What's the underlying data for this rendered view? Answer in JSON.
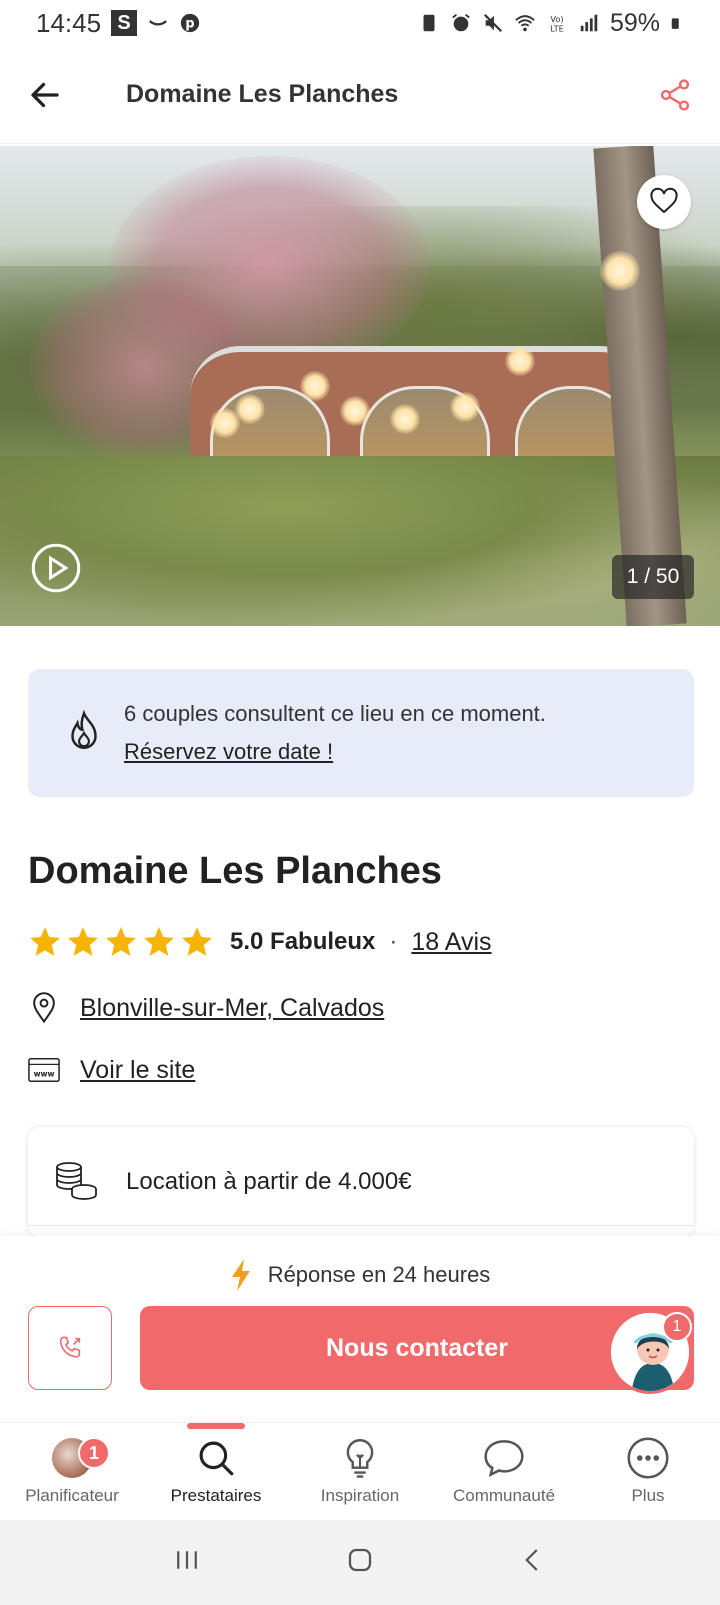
{
  "status_bar": {
    "time": "14:45",
    "s_icon_label": "S",
    "battery": "59%",
    "icons": [
      "s-app-icon",
      "amazon-icon",
      "pinterest-icon",
      "battery-saver-icon",
      "alarm-icon",
      "mute-icon",
      "wifi-icon",
      "volte-icon",
      "signal-icon",
      "battery-icon"
    ]
  },
  "app_bar": {
    "title": "Domaine Les Planches",
    "back_icon": "arrow-left-icon",
    "share_icon": "share-icon"
  },
  "hero": {
    "counter": "1 / 50",
    "favorite_icon": "heart-icon",
    "play_icon": "play-icon"
  },
  "banner": {
    "icon": "flame-icon",
    "line1": "6 couples consultent ce lieu en ce moment.",
    "link": "Réservez votre date !"
  },
  "venue": {
    "title": "Domaine Les Planches",
    "rating": 5,
    "rating_label": "5.0 Fabuleux",
    "separator": "·",
    "reviews": "18 Avis",
    "location": "Blonville-sur-Mer, Calvados",
    "website": "Voir le site"
  },
  "price": {
    "icon": "coins-icon",
    "text": "Location à partir de 4.000€"
  },
  "contact": {
    "response_icon": "lightning-icon",
    "response_text": "Réponse en 24 heures",
    "call_icon": "phone-icon",
    "button_label": "Nous contacter",
    "agent_badge": "1"
  },
  "bottom_nav": {
    "items": [
      {
        "label": "Planificateur",
        "icon": "planner-avatar",
        "badge": "1"
      },
      {
        "label": "Prestataires",
        "icon": "search-icon",
        "active": true
      },
      {
        "label": "Inspiration",
        "icon": "lightbulb-icon"
      },
      {
        "label": "Communauté",
        "icon": "chat-bubble-icon"
      },
      {
        "label": "Plus",
        "icon": "more-icon"
      }
    ]
  },
  "colors": {
    "accent": "#f06a6b",
    "banner_bg": "#e7ecf8",
    "star": "#f5b400"
  }
}
